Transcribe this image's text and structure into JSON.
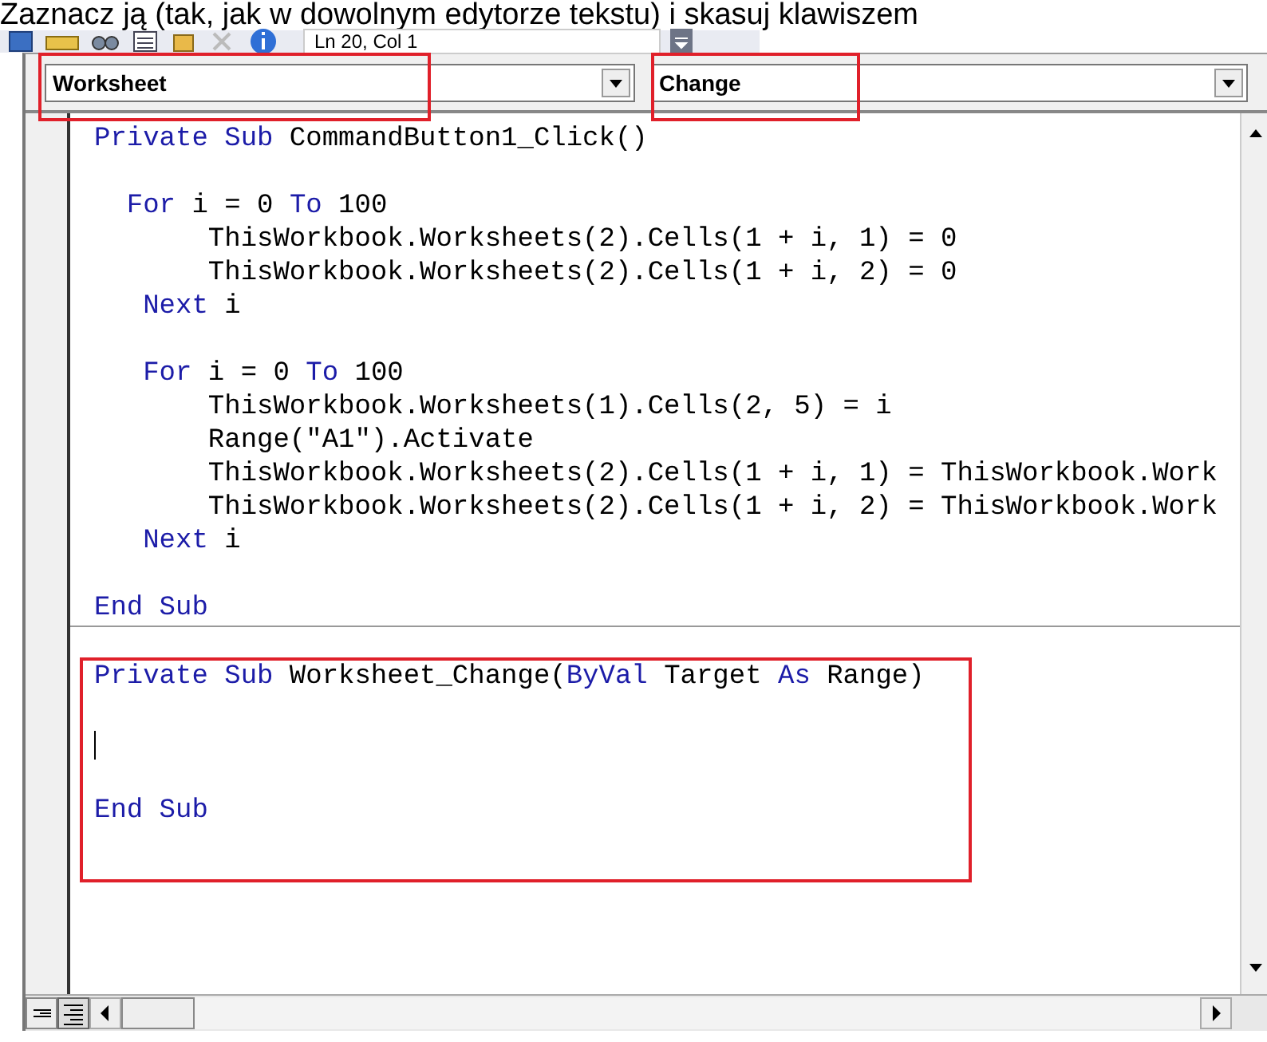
{
  "instruction_text": "Zaznacz ją (tak, jak w dowolnym edytorze tekstu) i skasuj klawiszem",
  "toolbar": {
    "position_field": "Ln 20, Col 1"
  },
  "object_combo": {
    "value": "Worksheet"
  },
  "procedure_combo": {
    "value": "Change"
  },
  "procedures": [
    {
      "lines": [
        {
          "kind": "code",
          "segments": [
            {
              "kind": "keyword",
              "text": "Private Sub"
            },
            {
              "kind": "plain",
              "text": " CommandButton1_Click()"
            }
          ]
        },
        {
          "kind": "blank"
        },
        {
          "kind": "code",
          "segments": [
            {
              "kind": "keyword",
              "text": "  For"
            },
            {
              "kind": "plain",
              "text": " i = 0 "
            },
            {
              "kind": "keyword",
              "text": "To"
            },
            {
              "kind": "plain",
              "text": " 100"
            }
          ]
        },
        {
          "kind": "code",
          "segments": [
            {
              "kind": "plain",
              "text": "       ThisWorkbook.Worksheets(2).Cells(1 + i, 1) = 0"
            }
          ]
        },
        {
          "kind": "code",
          "segments": [
            {
              "kind": "plain",
              "text": "       ThisWorkbook.Worksheets(2).Cells(1 + i, 2) = 0"
            }
          ]
        },
        {
          "kind": "code",
          "segments": [
            {
              "kind": "keyword",
              "text": "   Next"
            },
            {
              "kind": "plain",
              "text": " i"
            }
          ]
        },
        {
          "kind": "blank"
        },
        {
          "kind": "code",
          "segments": [
            {
              "kind": "keyword",
              "text": "   For"
            },
            {
              "kind": "plain",
              "text": " i = 0 "
            },
            {
              "kind": "keyword",
              "text": "To"
            },
            {
              "kind": "plain",
              "text": " 100"
            }
          ]
        },
        {
          "kind": "code",
          "segments": [
            {
              "kind": "plain",
              "text": "       ThisWorkbook.Worksheets(1).Cells(2, 5) = i"
            }
          ]
        },
        {
          "kind": "code",
          "segments": [
            {
              "kind": "plain",
              "text": "       Range(\"A1\").Activate"
            }
          ]
        },
        {
          "kind": "code",
          "segments": [
            {
              "kind": "plain",
              "text": "       ThisWorkbook.Worksheets(2).Cells(1 + i, 1) = ThisWorkbook.Work"
            }
          ]
        },
        {
          "kind": "code",
          "segments": [
            {
              "kind": "plain",
              "text": "       ThisWorkbook.Worksheets(2).Cells(1 + i, 2) = ThisWorkbook.Work"
            }
          ]
        },
        {
          "kind": "code",
          "segments": [
            {
              "kind": "keyword",
              "text": "   Next"
            },
            {
              "kind": "plain",
              "text": " i"
            }
          ]
        },
        {
          "kind": "blank"
        },
        {
          "kind": "code",
          "segments": [
            {
              "kind": "keyword",
              "text": "End Sub"
            }
          ]
        }
      ]
    },
    {
      "lines": [
        {
          "kind": "blank"
        },
        {
          "kind": "code",
          "segments": [
            {
              "kind": "keyword",
              "text": "Private Sub"
            },
            {
              "kind": "plain",
              "text": " Worksheet_Change("
            },
            {
              "kind": "keyword",
              "text": "ByVal"
            },
            {
              "kind": "plain",
              "text": " Target "
            },
            {
              "kind": "keyword",
              "text": "As"
            },
            {
              "kind": "plain",
              "text": " Range)"
            }
          ]
        },
        {
          "kind": "blank"
        },
        {
          "kind": "caret"
        },
        {
          "kind": "blank"
        },
        {
          "kind": "code",
          "segments": [
            {
              "kind": "keyword",
              "text": "End Sub"
            }
          ]
        }
      ]
    }
  ]
}
